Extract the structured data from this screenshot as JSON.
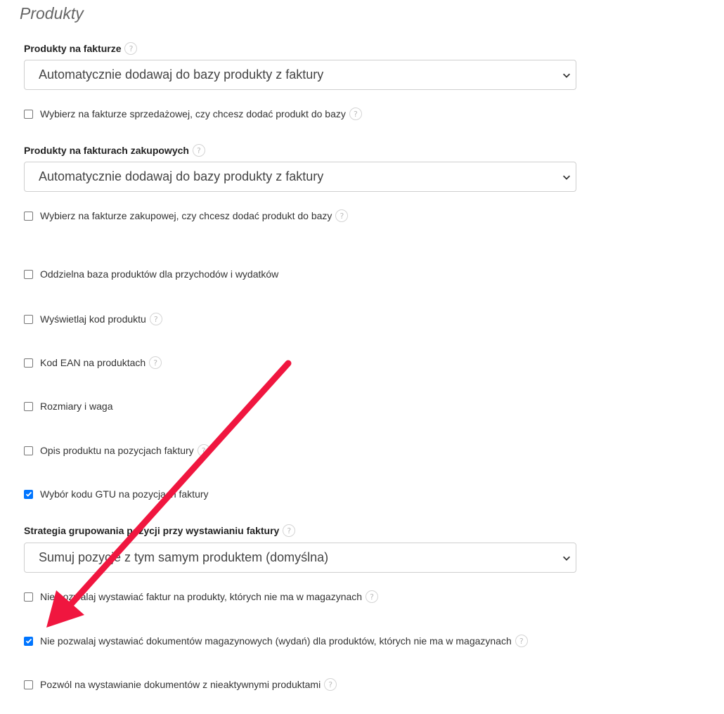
{
  "section": {
    "title": "Produkty"
  },
  "products_on_invoice": {
    "label": "Produkty na fakturze",
    "select_value": "Automatycznie dodawaj do bazy produkty z faktury",
    "checkbox_label": "Wybierz na fakturze sprzedażowej, czy chcesz dodać produkt do bazy",
    "checkbox_checked": false
  },
  "products_on_purchase_invoices": {
    "label": "Produkty na fakturach zakupowych",
    "select_value": "Automatycznie dodawaj do bazy produkty z faktury",
    "checkbox_label": "Wybierz na fakturze zakupowej, czy chcesz dodać produkt do bazy",
    "checkbox_checked": false
  },
  "options": {
    "separate_db": {
      "label": "Oddzielna baza produktów dla przychodów i wydatków",
      "checked": false
    },
    "show_code": {
      "label": "Wyświetlaj kod produktu",
      "checked": false
    },
    "ean": {
      "label": "Kod EAN na produktach",
      "checked": false
    },
    "dimensions": {
      "label": "Rozmiary i waga",
      "checked": false
    },
    "description": {
      "label": "Opis produktu na pozycjach faktury",
      "checked": false
    },
    "gtu": {
      "label": "Wybór kodu GTU na pozycjach faktury",
      "checked": true
    }
  },
  "grouping_strategy": {
    "label": "Strategia grupowania pozycji przy wystawianiu faktury",
    "select_value": "Sumuj pozycje z tym samym produktem (domyślna)"
  },
  "stock_options": {
    "no_invoice_without_stock": {
      "label": "Nie pozwalaj wystawiać faktur na produkty, których nie ma w magazynach",
      "checked": false
    },
    "no_warehouse_docs_without_stock": {
      "label": "Nie pozwalaj wystawiać dokumentów magazynowych (wydań) dla produktów, których nie ma w magazynach",
      "checked": true
    },
    "allow_inactive_products": {
      "label": "Pozwól na wystawianie dokumentów z nieaktywnymi produktami",
      "checked": false
    }
  },
  "help_symbol": "?",
  "colors": {
    "accent": "#0075ff",
    "annotation_arrow": "#f0163f"
  },
  "icons": {
    "select_chevron": "chevron-down-icon",
    "help": "question-mark-icon",
    "checkmark": "checkmark-icon",
    "annotation": "red-arrow-annotation"
  }
}
